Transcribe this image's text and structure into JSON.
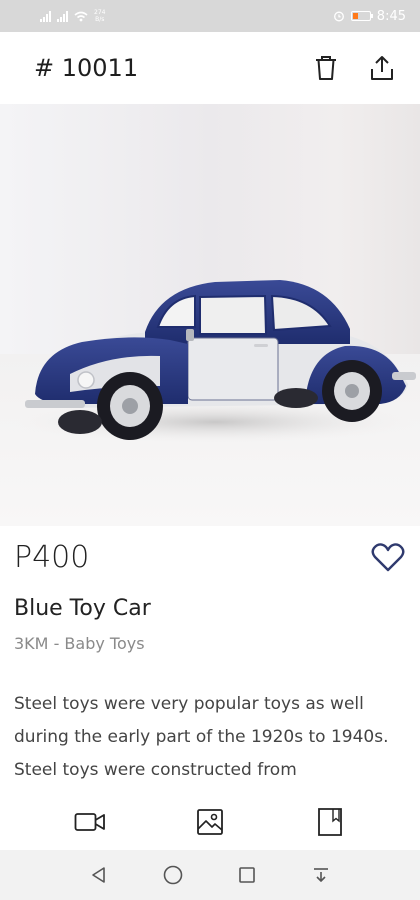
{
  "status_bar": {
    "speed_value": "274",
    "speed_unit": "B/s",
    "time": "8:45",
    "battery_level": 0.35,
    "battery_color": "#ff7a1a"
  },
  "header": {
    "title": "# 10011",
    "delete_icon": "trash-icon",
    "share_icon": "share-icon"
  },
  "product": {
    "image_icon": "toy-car-photo",
    "price": "P400",
    "name": "Blue Toy Car",
    "meta": "3KM - Baby Toys",
    "description": "Steel toys were very popular toys as well during the early part of the 1920s to 1940s. Steel toys were constructed from",
    "favorite_icon": "heart-icon",
    "accent_color": "#2f3a6e"
  },
  "actions": {
    "video_icon": "video-camera-icon",
    "gallery_icon": "image-icon",
    "document_icon": "document-icon"
  },
  "nav": {
    "back_icon": "back-triangle-icon",
    "home_icon": "home-circle-icon",
    "recents_icon": "recents-square-icon",
    "menu_icon": "notification-down-icon"
  }
}
